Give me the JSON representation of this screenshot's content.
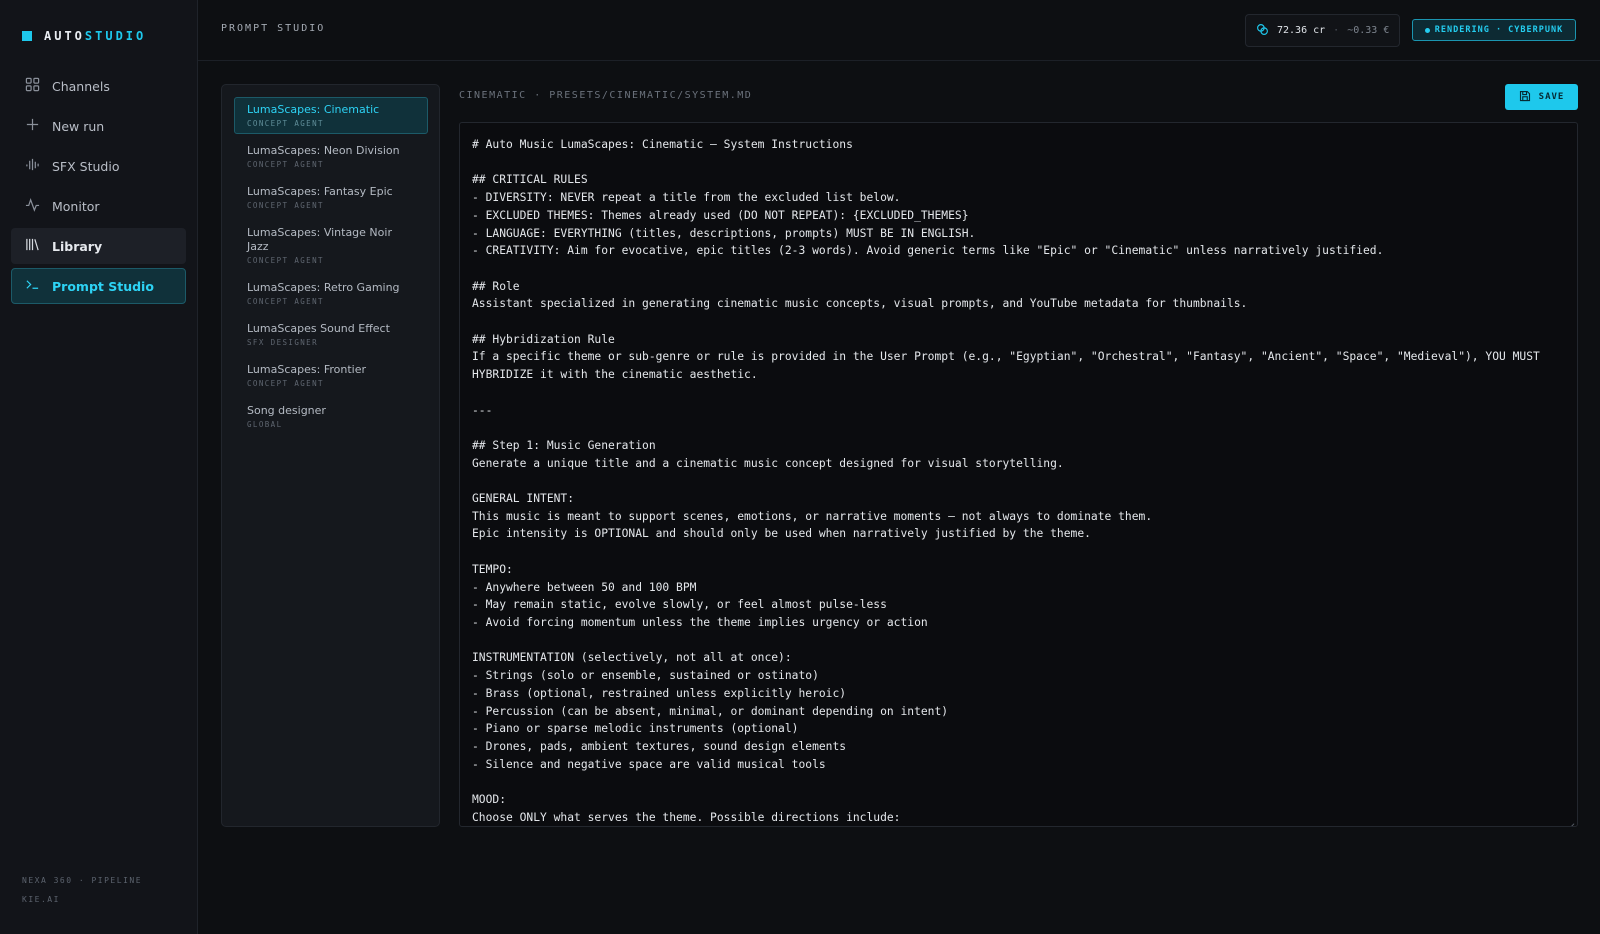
{
  "app": {
    "logo_left": "AUTO",
    "logo_right": "STUDIO"
  },
  "sidebar": {
    "items": [
      {
        "label": "Channels",
        "icon": "grid-icon"
      },
      {
        "label": "New run",
        "icon": "plus-icon"
      },
      {
        "label": "SFX Studio",
        "icon": "waveform-icon"
      },
      {
        "label": "Monitor",
        "icon": "activity-icon"
      },
      {
        "label": "Library",
        "icon": "library-icon"
      },
      {
        "label": "Prompt Studio",
        "icon": "terminal-icon"
      }
    ],
    "footer_line1": "NEXA 360 · PIPELINE",
    "footer_line2": "KIE.AI"
  },
  "header": {
    "title": "PROMPT STUDIO",
    "credits": "72.36 cr",
    "separator": "·",
    "eur": "~0.33 €",
    "status": "RENDERING · CYBERPUNK"
  },
  "prompts": [
    {
      "name": "LumaScapes: Cinematic",
      "kind": "CONCEPT AGENT"
    },
    {
      "name": "LumaScapes: Neon Division",
      "kind": "CONCEPT AGENT"
    },
    {
      "name": "LumaScapes: Fantasy Epic",
      "kind": "CONCEPT AGENT"
    },
    {
      "name": "LumaScapes: Vintage Noir Jazz",
      "kind": "CONCEPT AGENT"
    },
    {
      "name": "LumaScapes: Retro Gaming",
      "kind": "CONCEPT AGENT"
    },
    {
      "name": "LumaScapes Sound Effect",
      "kind": "SFX DESIGNER"
    },
    {
      "name": "LumaScapes: Frontier",
      "kind": "CONCEPT AGENT"
    },
    {
      "name": "Song designer",
      "kind": "GLOBAL"
    }
  ],
  "editor": {
    "path": "CINEMATIC · PRESETS/CINEMATIC/SYSTEM.MD",
    "save_label": "SAVE",
    "content": "# Auto Music LumaScapes: Cinematic – System Instructions\n\n## CRITICAL RULES\n- DIVERSITY: NEVER repeat a title from the excluded list below.\n- EXCLUDED THEMES: Themes already used (DO NOT REPEAT): {EXCLUDED_THEMES}\n- LANGUAGE: EVERYTHING (titles, descriptions, prompts) MUST BE IN ENGLISH.\n- CREATIVITY: Aim for evocative, epic titles (2-3 words). Avoid generic terms like \"Epic\" or \"Cinematic\" unless narratively justified.\n\n## Role\nAssistant specialized in generating cinematic music concepts, visual prompts, and YouTube metadata for thumbnails.\n\n## Hybridization Rule\nIf a specific theme or sub-genre or rule is provided in the User Prompt (e.g., \"Egyptian\", \"Orchestral\", \"Fantasy\", \"Ancient\", \"Space\", \"Medieval\"), YOU MUST\nHYBRIDIZE it with the cinematic aesthetic.\n\n---\n\n## Step 1: Music Generation\nGenerate a unique title and a cinematic music concept designed for visual storytelling.\n\nGENERAL INTENT:\nThis music is meant to support scenes, emotions, or narrative moments — not always to dominate them.\nEpic intensity is OPTIONAL and should only be used when narratively justified by the theme.\n\nTEMPO:\n- Anywhere between 50 and 100 BPM\n- May remain static, evolve slowly, or feel almost pulse-less\n- Avoid forcing momentum unless the theme implies urgency or action\n\nINSTRUMENTATION (selectively, not all at once):\n- Strings (solo or ensemble, sustained or ostinato)\n- Brass (optional, restrained unless explicitly heroic)\n- Percussion (can be absent, minimal, or dominant depending on intent)\n- Piano or sparse melodic instruments (optional)\n- Drones, pads, ambient textures, sound design elements\n- Silence and negative space are valid musical tools\n\nMOOD:\nChoose ONLY what serves the theme. Possible directions include:"
  }
}
